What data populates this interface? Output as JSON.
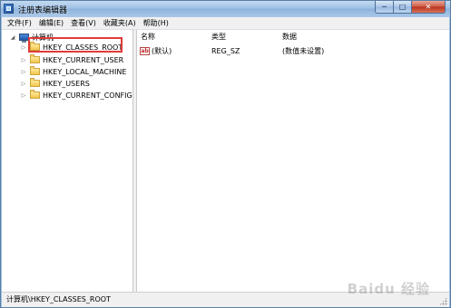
{
  "window": {
    "title": "注册表编辑器",
    "buttons": {
      "minimize": "─",
      "maximize": "□",
      "close": "✕"
    }
  },
  "menubar": {
    "items": [
      "文件(F)",
      "编辑(E)",
      "查看(V)",
      "收藏夹(A)",
      "帮助(H)"
    ]
  },
  "tree": {
    "root": {
      "label": "计算机",
      "icon": "computer-icon",
      "expanded": true
    },
    "items": [
      {
        "label": "HKEY_CLASSES_ROOT",
        "icon": "folder-icon",
        "selected": true,
        "highlighted": true
      },
      {
        "label": "HKEY_CURRENT_USER",
        "icon": "folder-icon"
      },
      {
        "label": "HKEY_LOCAL_MACHINE",
        "icon": "folder-icon"
      },
      {
        "label": "HKEY_USERS",
        "icon": "folder-icon"
      },
      {
        "label": "HKEY_CURRENT_CONFIG",
        "icon": "folder-icon"
      }
    ]
  },
  "list": {
    "columns": [
      "名称",
      "类型",
      "数据"
    ],
    "rows": [
      {
        "name": "(默认)",
        "type": "REG_SZ",
        "data": "(数值未设置)",
        "icon": "string-value-icon",
        "icon_text": "ab"
      }
    ]
  },
  "status": {
    "path": "计算机\\HKEY_CLASSES_ROOT"
  },
  "watermark": {
    "text": "Baidu 经验"
  },
  "colors": {
    "highlight_border": "#e23a3a",
    "titlebar": "#9ec0e6"
  }
}
